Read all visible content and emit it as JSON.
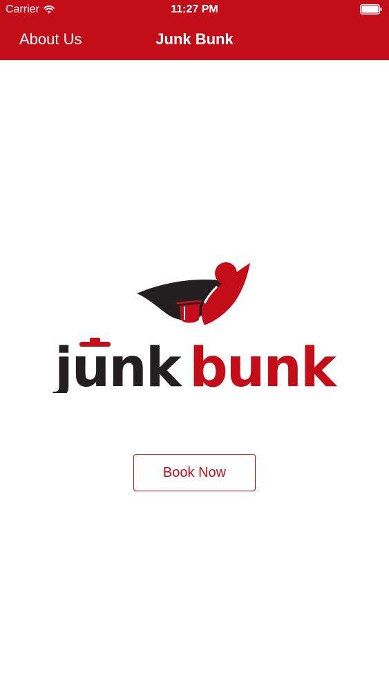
{
  "status_bar": {
    "carrier": "Carrier",
    "time": "11:27 PM",
    "wifi_icon": "wifi-icon",
    "battery_icon": "battery-icon"
  },
  "nav_bar": {
    "left_link": "About Us",
    "title": "Junk Bunk"
  },
  "logo": {
    "icon": "junkbunk-logo",
    "text_part1": "junk",
    "text_part2": "bunk"
  },
  "main": {
    "book_button_label": "Book Now"
  },
  "colors": {
    "brand_red": "#c30e1a",
    "logo_dark": "#231f20",
    "background": "#ffffff"
  }
}
